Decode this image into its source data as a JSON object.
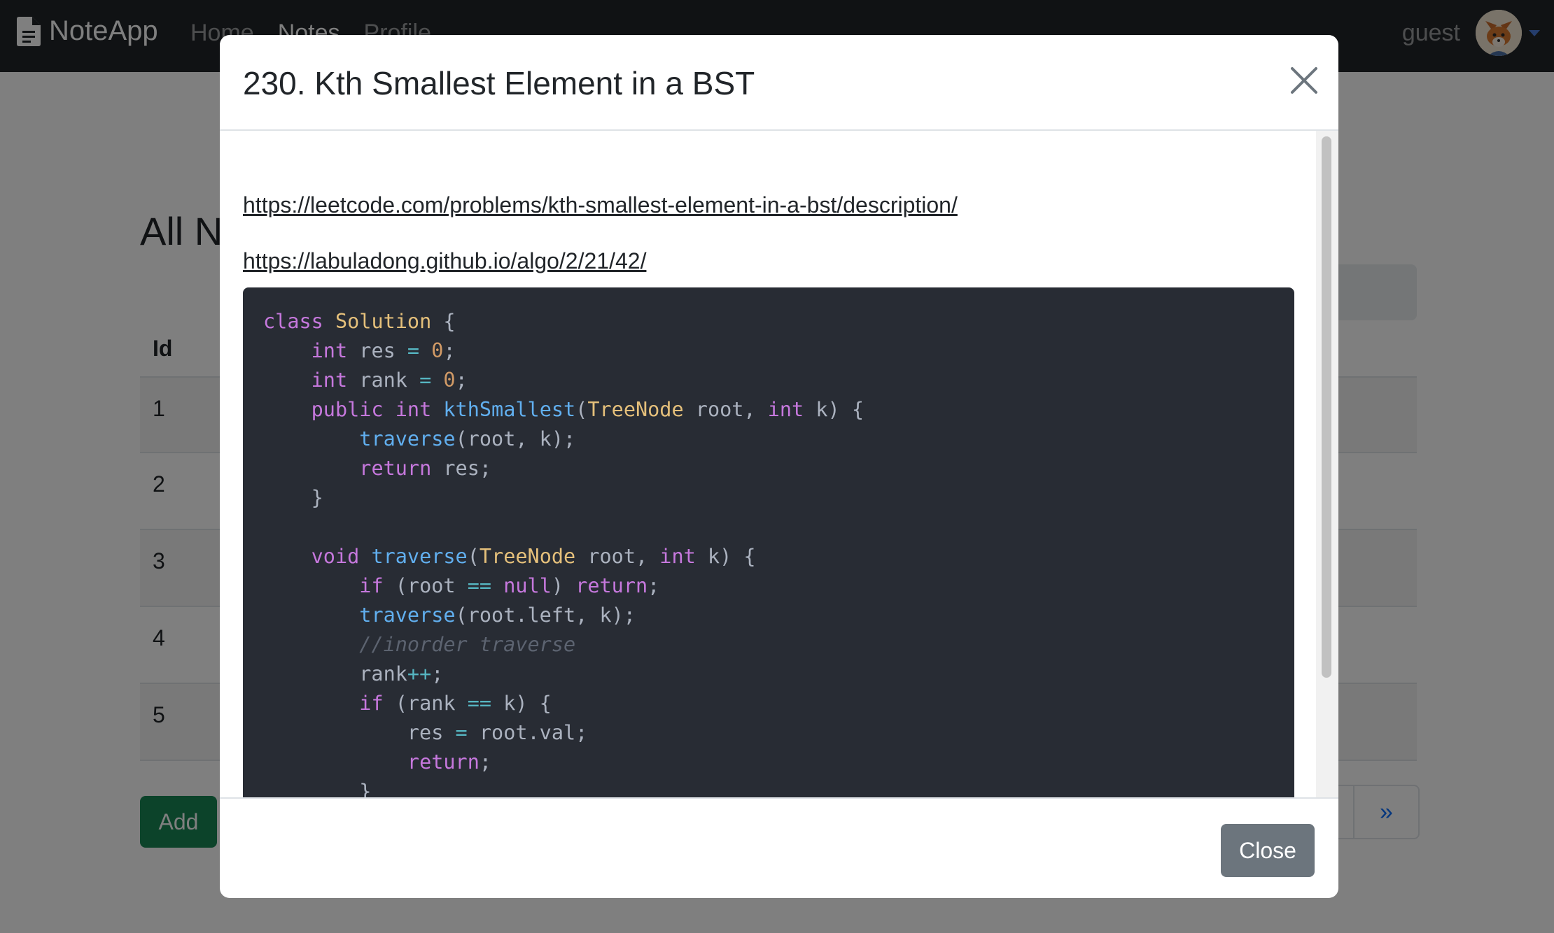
{
  "navbar": {
    "brand": "NoteApp",
    "links": [
      "Home",
      "Notes",
      "Profile"
    ],
    "active_link": "Notes",
    "user": "guest"
  },
  "page": {
    "title": "All N",
    "table": {
      "header_id": "Id",
      "row_ids": [
        "1",
        "2",
        "3",
        "4",
        "5"
      ]
    },
    "add_button": "Add",
    "pagination": [
      "›",
      "»"
    ]
  },
  "modal": {
    "title": "230. Kth Smallest Element in a BST",
    "links": [
      "https://leetcode.com/problems/kth-smallest-element-in-a-bst/description/",
      "https://labuladong.github.io/algo/2/21/42/"
    ],
    "code_language": "java",
    "code_lines": [
      "class Solution {",
      "    int res = 0;",
      "    int rank = 0;",
      "    public int kthSmallest(TreeNode root, int k) {",
      "        traverse(root, k);",
      "        return res;",
      "    }",
      "",
      "    void traverse(TreeNode root, int k) {",
      "        if (root == null) return;",
      "        traverse(root.left, k);",
      "        //inorder traverse",
      "        rank++;",
      "        if (rank == k) {",
      "            res = root.val;",
      "            return;",
      "        }"
    ],
    "close_button": "Close"
  }
}
